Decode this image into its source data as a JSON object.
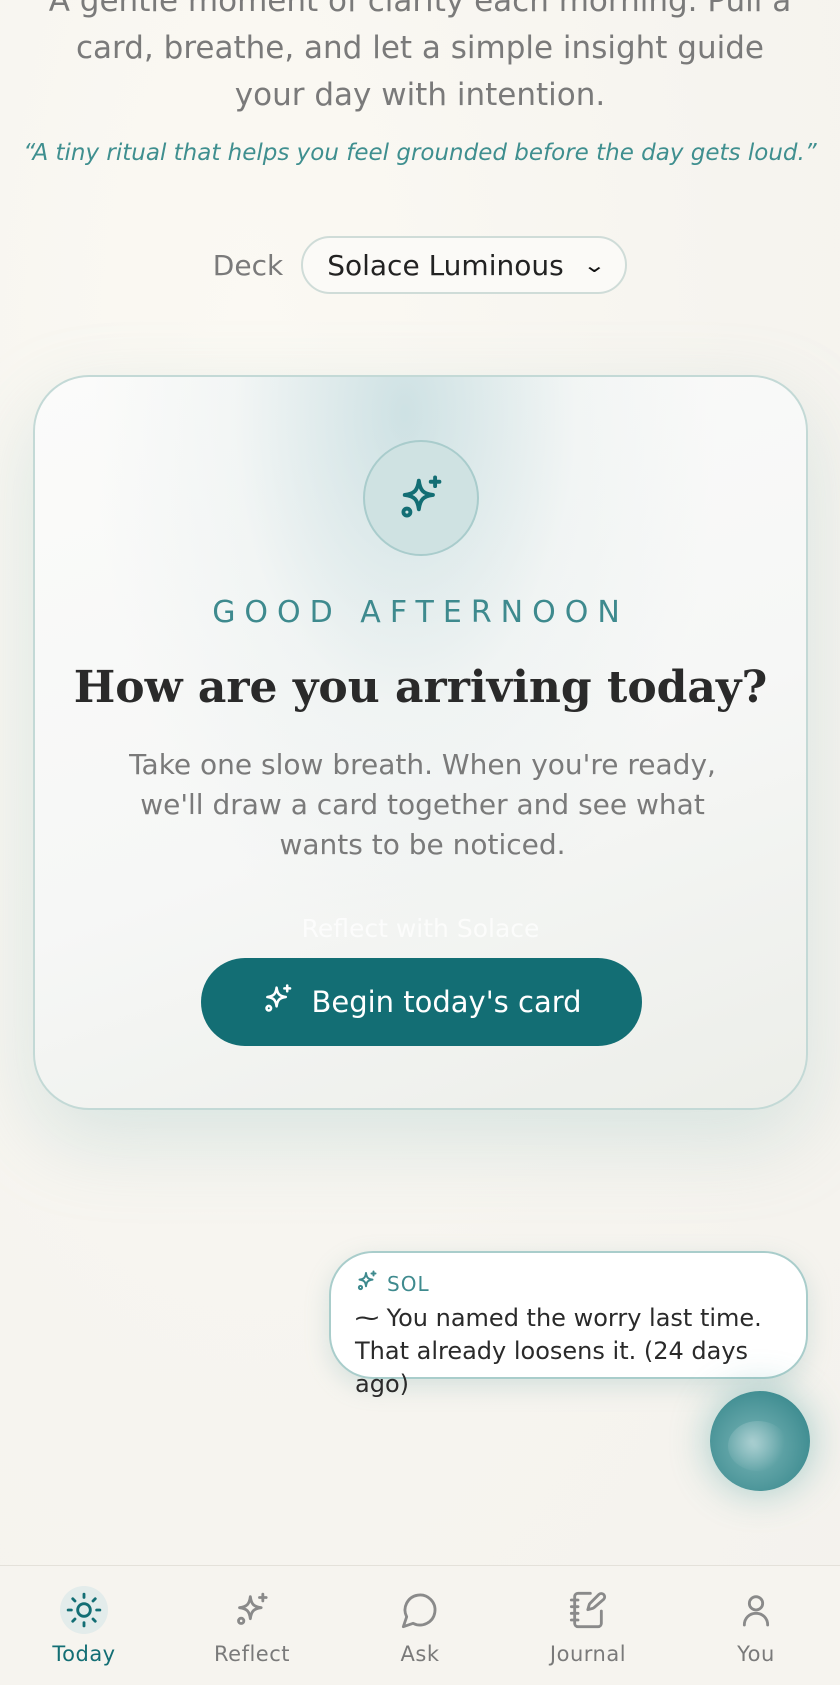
{
  "intro": {
    "text": "A gentle moment of clarity each morning. Pull a card, breathe, and let a simple insight guide your day with intention.",
    "quote": "“A tiny ritual that helps you feel grounded before the day gets loud.”"
  },
  "deck": {
    "label": "Deck",
    "selected": "Solace Luminous"
  },
  "card": {
    "icon": "sparkles-icon",
    "greeting": "GOOD AFTERNOON",
    "title": "How are you arriving today?",
    "body": "Take one slow breath. When you're ready, we'll draw a card together and see what wants to be noticed.",
    "ghost_label": "Reflect with Solace",
    "button_label": "Begin today's card"
  },
  "sol": {
    "label": "SOL",
    "message": "⁓ You named the worry last time. That already loosens it. (24 days ago)"
  },
  "tabs": [
    {
      "label": "Today",
      "icon": "sun-icon",
      "active": true
    },
    {
      "label": "Reflect",
      "icon": "sparkles-icon",
      "active": false
    },
    {
      "label": "Ask",
      "icon": "chat-bubble-icon",
      "active": false
    },
    {
      "label": "Journal",
      "icon": "notebook-pen-icon",
      "active": false
    },
    {
      "label": "You",
      "icon": "user-icon",
      "active": false
    }
  ],
  "colors": {
    "accent": "#136e74",
    "accent_text": "#3e8a8e",
    "background": "#f7f5f1"
  }
}
